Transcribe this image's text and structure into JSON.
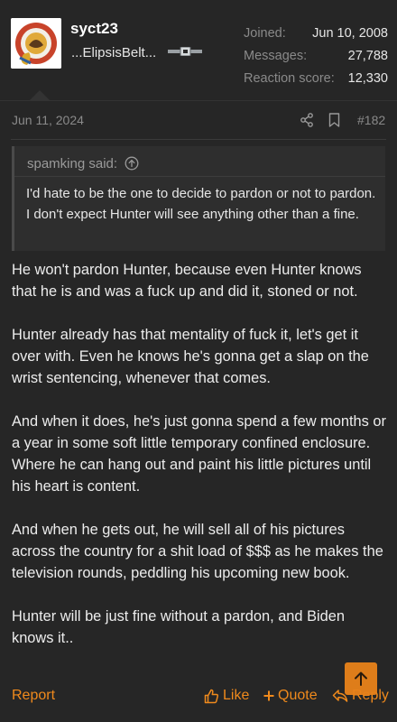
{
  "user": {
    "username": "syct23",
    "title": "...ElipsisBelt...",
    "avatar_icon": "badge-avatar-icon",
    "belt_icon": "belt-icon",
    "stats": [
      {
        "label": "Joined:",
        "value": "Jun 10, 2008"
      },
      {
        "label": "Messages:",
        "value": "27,788"
      },
      {
        "label": "Reaction score:",
        "value": "12,330"
      }
    ]
  },
  "post": {
    "date": "Jun 11, 2024",
    "number": "#182"
  },
  "quote": {
    "author_line": "spamking said:",
    "text": "I'd hate to be the one to decide to pardon or not to pardon. I don't expect Hunter will see anything other than a fine."
  },
  "message": {
    "paragraphs": [
      "He won't pardon Hunter, because even Hunter knows that he is and was a fuck up and did it, stoned or not.",
      "Hunter already has that mentality of fuck it, let's get it over with. Even he knows he's gonna get a slap on the wrist sentencing, whenever that comes.",
      "And when it does, he's just gonna spend a few months or a year in some soft little temporary confined enclosure. Where he can hang out and paint his little pictures until his heart is content.",
      "And when he gets out, he will sell all of his pictures across the country for a shit load of $$$ as he makes the television rounds, peddling his upcoming new book.",
      "Hunter will be just fine without a pardon, and Biden knows it.."
    ]
  },
  "actions": {
    "report": "Report",
    "like": "Like",
    "quote": "Quote",
    "reply": "Reply"
  },
  "colors": {
    "accent": "#f08a1c",
    "background": "#262626",
    "quote_background": "#2e2e2e"
  }
}
